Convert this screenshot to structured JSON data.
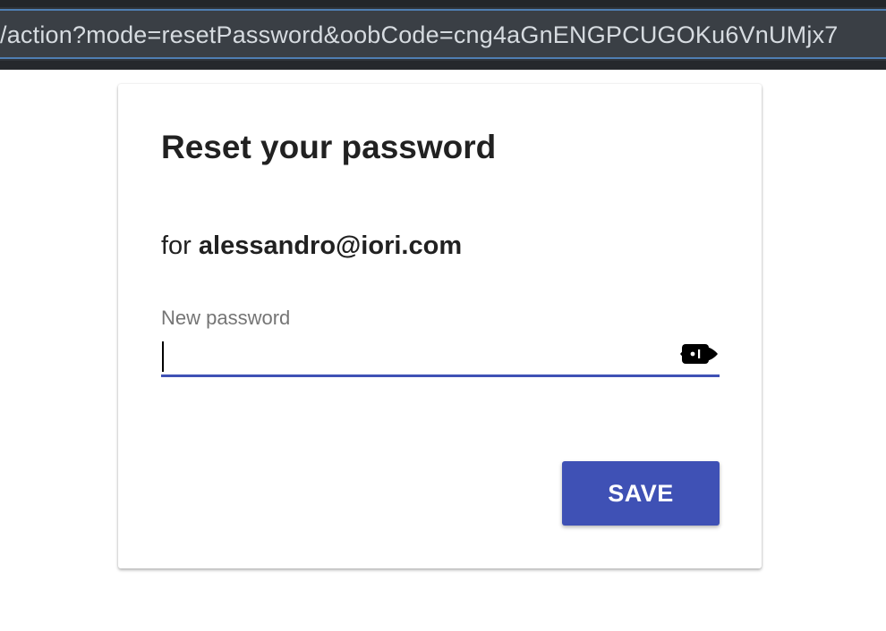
{
  "browser": {
    "url": "/action?mode=resetPassword&oobCode=cng4aGnENGPCUGOKu6VnUMjx7"
  },
  "card": {
    "title": "Reset your password",
    "subtitle_prefix": "for",
    "email": "alessandro@iori.com",
    "field_label": "New password",
    "password_value": "",
    "visibility_icon": "eye-icon",
    "save_label": "SAVE",
    "accent_color": "#3f51b5"
  }
}
